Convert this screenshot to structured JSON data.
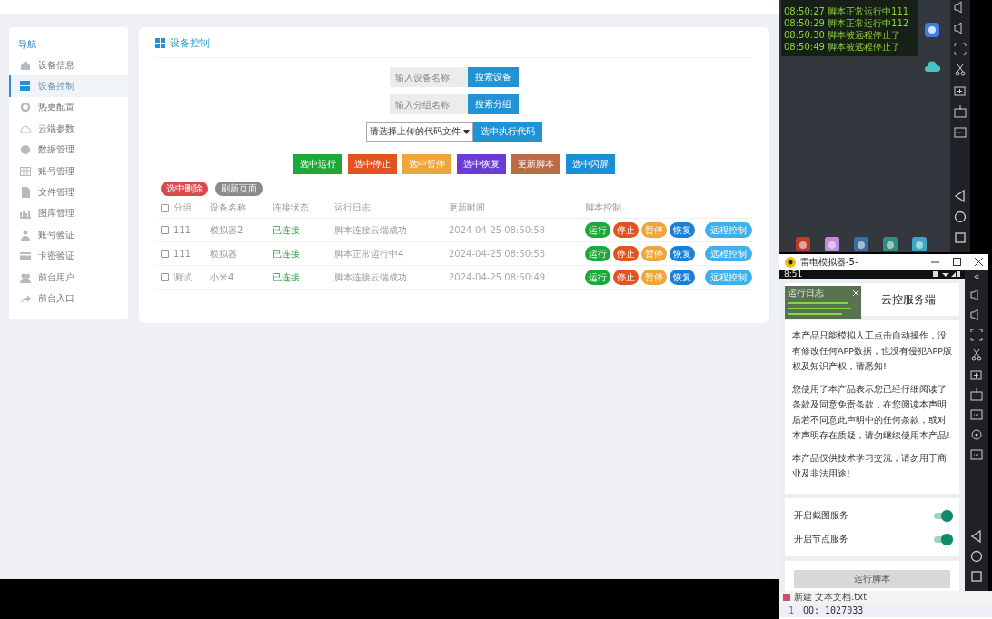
{
  "sidebar": {
    "heading": "导航",
    "items": [
      {
        "label": "设备信息",
        "selected": false
      },
      {
        "label": "设备控制",
        "selected": true
      },
      {
        "label": "热更配置",
        "selected": false
      },
      {
        "label": "云端参数",
        "selected": false
      },
      {
        "label": "数据管理",
        "selected": false
      },
      {
        "label": "账号管理",
        "selected": false
      },
      {
        "label": "文件管理",
        "selected": false
      },
      {
        "label": "图库管理",
        "selected": false
      },
      {
        "label": "账号验证",
        "selected": false
      },
      {
        "label": "卡密验证",
        "selected": false
      },
      {
        "label": "前台用户",
        "selected": false
      },
      {
        "label": "前台入口",
        "selected": false
      }
    ]
  },
  "panel": {
    "title": "设备控制",
    "searches": [
      {
        "placeholder": "输入设备名称",
        "button": "搜索设备"
      },
      {
        "placeholder": "输入分组名称",
        "button": "搜索分组"
      }
    ],
    "code_select": {
      "value": "请选择上传的代码文件",
      "button": "选中执行代码"
    },
    "actions": [
      {
        "label": "选中运行",
        "color": "#1fa83a"
      },
      {
        "label": "选中停止",
        "color": "#e2531f"
      },
      {
        "label": "选中暂停",
        "color": "#eea53a"
      },
      {
        "label": "选中恢复",
        "color": "#6a3bd6"
      },
      {
        "label": "更新脚本",
        "color": "#b86b45"
      },
      {
        "label": "选中闪屏",
        "color": "#1a8fd6"
      }
    ],
    "badges": [
      {
        "label": "选中删除",
        "color": "#d94a4a"
      },
      {
        "label": "刷新页面",
        "color": "#8a8a8a"
      }
    ],
    "table": {
      "header_checked": false,
      "columns": [
        "分组",
        "设备名称",
        "连接状态",
        "运行日志",
        "更新时间",
        "脚本控制"
      ],
      "rows": [
        {
          "checked": false,
          "group": "111",
          "name": "模拟器2",
          "status": "已连接",
          "log": "脚本连接云端成功",
          "time": "2024-04-25 08:50:58",
          "controls": [
            {
              "label": "运行",
              "color": "#1fa83a"
            },
            {
              "label": "停止",
              "color": "#e2531f"
            },
            {
              "label": "暂停",
              "color": "#eea53a"
            },
            {
              "label": "恢复",
              "color": "#1a7fd6"
            },
            {
              "label": "远程控制",
              "color": "#3fb0ea"
            }
          ]
        },
        {
          "checked": false,
          "group": "111",
          "name": "模拟器",
          "status": "已连接",
          "log": "脚本正常运行中4",
          "time": "2024-04-25 08:50:53",
          "controls": [
            {
              "label": "运行",
              "color": "#1fa83a"
            },
            {
              "label": "停止",
              "color": "#e2531f"
            },
            {
              "label": "暂停",
              "color": "#eea53a"
            },
            {
              "label": "恢复",
              "color": "#1a7fd6"
            },
            {
              "label": "远程控制",
              "color": "#3fb0ea"
            }
          ]
        },
        {
          "checked": false,
          "group": "测试",
          "name": "小米4",
          "status": "已连接",
          "log": "脚本连接云端成功",
          "time": "2024-04-25 08:50:49",
          "controls": [
            {
              "label": "运行",
              "color": "#1fa83a"
            },
            {
              "label": "停止",
              "color": "#e2531f"
            },
            {
              "label": "暂停",
              "color": "#eea53a"
            },
            {
              "label": "恢复",
              "color": "#1a7fd6"
            },
            {
              "label": "远程控制",
              "color": "#3fb0ea"
            }
          ]
        }
      ]
    }
  },
  "emulator_top": {
    "log_lines": [
      "08:50:27 脚本正常运行中111",
      "08:50:29 脚本正常运行中112",
      "08:50:30 脚本被远程停止了",
      "08:50:49 脚本被远程停止了"
    ]
  },
  "emulator": {
    "title": "雷电模拟器-5-",
    "collapse": "«",
    "time": "8:51",
    "app_title": "云控服务端",
    "log_overlay_title": "运行日志",
    "paragraphs": [
      "本产品只能模拟人工点击自动操作，没有修改任何APP数据，也没有侵犯APP版权及知识产权，请悉知!",
      "您使用了本产品表示您已经仔细阅读了条款及同意免责条款，在您阅读本声明后若不同意此声明中的任何条款，或对本声明存在质疑，请勿继续使用本产品!",
      "本产品仅供技术学习交流，请勿用于商业及非法用途!"
    ],
    "switches": [
      {
        "label": "开启截图服务",
        "on": true
      },
      {
        "label": "开启节点服务",
        "on": true
      }
    ],
    "run_button": "运行脚本"
  },
  "notepad": {
    "title": "新建 文本文档.txt",
    "lines": [
      {
        "number": "1",
        "text": "QQ: 1027033"
      }
    ]
  }
}
